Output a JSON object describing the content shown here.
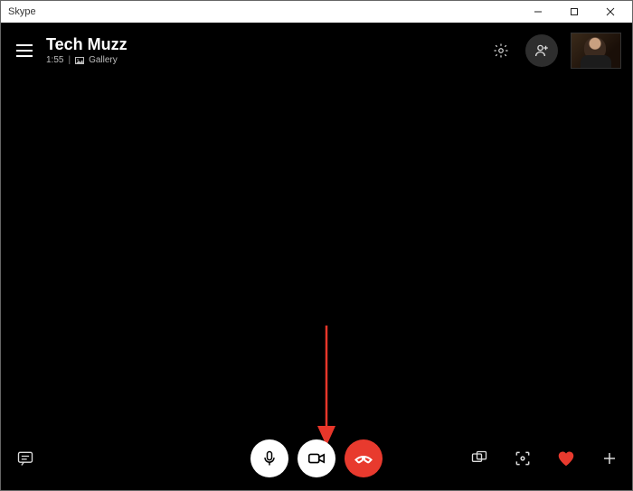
{
  "window": {
    "app_title": "Skype"
  },
  "header": {
    "call_title": "Tech Muzz",
    "duration": "1:55",
    "separator": "|",
    "gallery_label": "Gallery"
  },
  "icons": {
    "hamburger": "menu-icon",
    "settings": "gear-icon",
    "add_participant": "add-person-icon",
    "chat": "chat-icon",
    "mic": "microphone-icon",
    "video": "video-icon",
    "hangup": "hangup-icon",
    "share_screen": "share-screen-icon",
    "snapshot": "snapshot-icon",
    "heart": "heart-icon",
    "plus": "plus-icon"
  },
  "colors": {
    "hangup": "#e83a2e",
    "heart": "#e83a2e",
    "button_white": "#ffffff",
    "bg": "#000000"
  },
  "annotation": {
    "arrow_target": "video-toggle-button"
  }
}
